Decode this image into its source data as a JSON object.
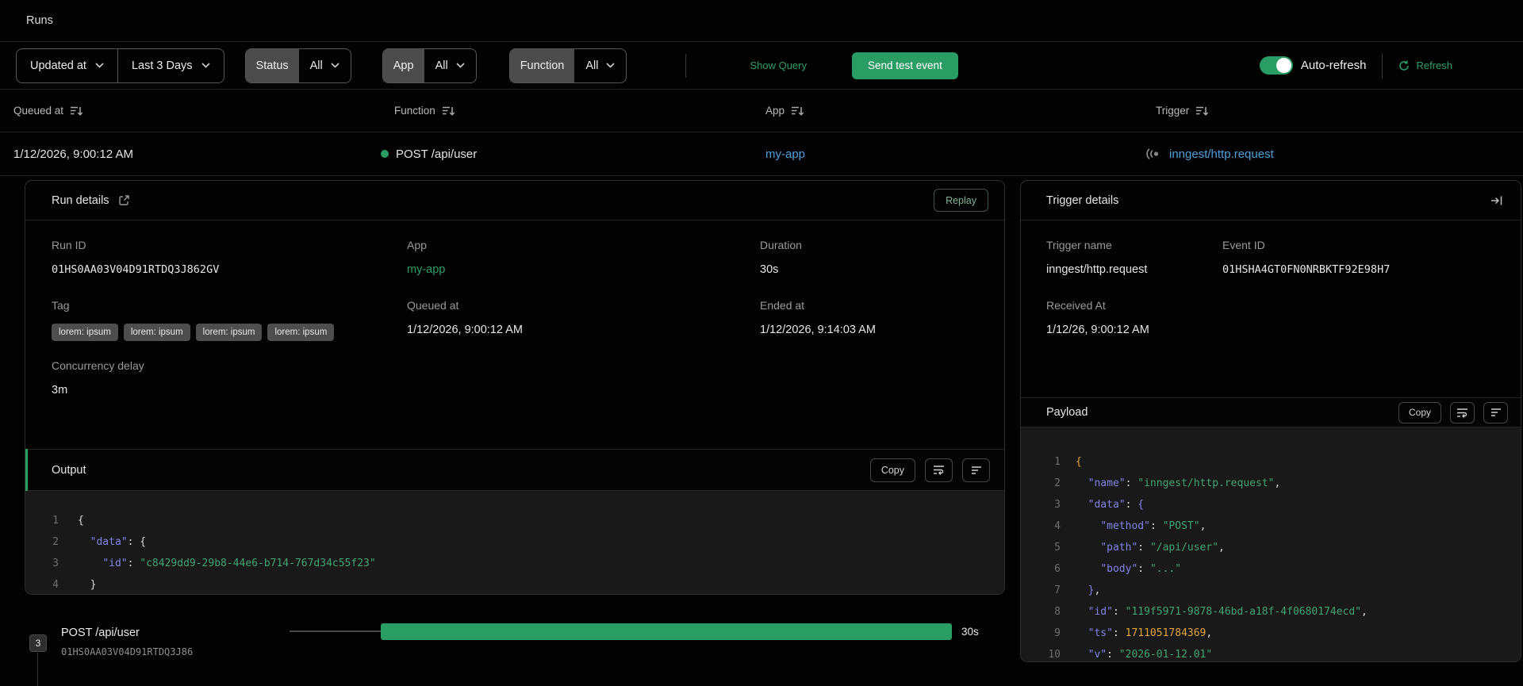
{
  "page": {
    "title": "Runs"
  },
  "colors": {
    "accent_green": "#2a9d64",
    "link_green": "#2f9e68",
    "link_blue": "#4f9fdd",
    "code_key": "#8383e2",
    "code_string": "#43a375",
    "code_number": "#e0a43a"
  },
  "filters": {
    "time_field": "Updated at",
    "time_range": "Last 3 Days",
    "status": {
      "label": "Status",
      "value": "All"
    },
    "app": {
      "label": "App",
      "value": "All"
    },
    "function": {
      "label": "Function",
      "value": "All"
    },
    "show_query": "Show Query",
    "send_test_event": "Send test event",
    "auto_refresh_label": "Auto-refresh",
    "auto_refresh_on": true,
    "refresh_label": "Refresh"
  },
  "table": {
    "columns": [
      "Queued at",
      "Function",
      "App",
      "Trigger"
    ],
    "row": {
      "queued_at": "1/12/2026, 9:00:12 AM",
      "function": "POST /api/user",
      "app": "my-app",
      "trigger": "inngest/http.request"
    }
  },
  "run_details": {
    "title": "Run details",
    "replay_label": "Replay",
    "run_id": {
      "label": "Run ID",
      "value": "01HS0AA03V04D91RTDQ3J862GV"
    },
    "app": {
      "label": "App",
      "value": "my-app"
    },
    "duration": {
      "label": "Duration",
      "value": "30s"
    },
    "tag_label": "Tag",
    "tags": [
      "lorem: ipsum",
      "lorem: ipsum",
      "lorem: ipsum",
      "lorem: ipsum"
    ],
    "queued_at": {
      "label": "Queued at",
      "value": "1/12/2026, 9:00:12 AM"
    },
    "ended_at": {
      "label": "Ended at",
      "value": "1/12/2026, 9:14:03 AM"
    },
    "concurrency": {
      "label": "Concurrency delay",
      "value": "3m"
    },
    "output": {
      "title": "Output",
      "copy_label": "Copy",
      "lines": [
        [
          [
            "p",
            "{"
          ]
        ],
        [
          [
            "p",
            "  "
          ],
          [
            "k",
            "\"data\""
          ],
          [
            "p",
            ": {"
          ]
        ],
        [
          [
            "p",
            "    "
          ],
          [
            "k",
            "\"id\""
          ],
          [
            "p",
            ": "
          ],
          [
            "s",
            "\"c8429dd9-29b8-44e6-b714-767d34c55f23\""
          ]
        ],
        [
          [
            "p",
            "  }"
          ]
        ],
        [
          [
            "p",
            "}"
          ]
        ]
      ]
    }
  },
  "trigger_details": {
    "title": "Trigger details",
    "trigger_name": {
      "label": "Trigger name",
      "value": "inngest/http.request"
    },
    "event_id": {
      "label": "Event ID",
      "value": "01HSHA4GT0FN0NRBKTF92E98H7"
    },
    "received_at": {
      "label": "Received At",
      "value": "1/12/26, 9:00:12 AM"
    },
    "payload": {
      "title": "Payload",
      "copy_label": "Copy",
      "lines": [
        [
          [
            "b0",
            "{"
          ]
        ],
        [
          [
            "p",
            "  "
          ],
          [
            "k",
            "\"name\""
          ],
          [
            "p",
            ": "
          ],
          [
            "s",
            "\"inngest/http.request\""
          ],
          [
            "p",
            ","
          ]
        ],
        [
          [
            "p",
            "  "
          ],
          [
            "k",
            "\"data\""
          ],
          [
            "p",
            ": "
          ],
          [
            "b1",
            "{"
          ]
        ],
        [
          [
            "p",
            "    "
          ],
          [
            "k",
            "\"method\""
          ],
          [
            "p",
            ": "
          ],
          [
            "s",
            "\"POST\""
          ],
          [
            "p",
            ","
          ]
        ],
        [
          [
            "p",
            "    "
          ],
          [
            "k",
            "\"path\""
          ],
          [
            "p",
            ": "
          ],
          [
            "s",
            "\"/api/user\""
          ],
          [
            "p",
            ","
          ]
        ],
        [
          [
            "p",
            "    "
          ],
          [
            "k",
            "\"body\""
          ],
          [
            "p",
            ": "
          ],
          [
            "s",
            "\"...\""
          ]
        ],
        [
          [
            "p",
            "  "
          ],
          [
            "b1",
            "}"
          ],
          [
            "p",
            ","
          ]
        ],
        [
          [
            "p",
            "  "
          ],
          [
            "k",
            "\"id\""
          ],
          [
            "p",
            ": "
          ],
          [
            "s",
            "\"119f5971-9878-46bd-a18f-4f0680174ecd\""
          ],
          [
            "p",
            ","
          ]
        ],
        [
          [
            "p",
            "  "
          ],
          [
            "k",
            "\"ts\""
          ],
          [
            "p",
            ": "
          ],
          [
            "n",
            "1711051784369"
          ],
          [
            "p",
            ","
          ]
        ],
        [
          [
            "p",
            "  "
          ],
          [
            "k",
            "\"v\""
          ],
          [
            "p",
            ": "
          ],
          [
            "s",
            "\"2026-01-12.01\""
          ]
        ],
        [
          [
            "b0",
            "}"
          ]
        ]
      ]
    }
  },
  "timeline": {
    "step_count": "3",
    "function_name": "POST /api/user",
    "run_id": "01HS0AA03V04D91RTDQ3J86",
    "duration": "30s"
  }
}
